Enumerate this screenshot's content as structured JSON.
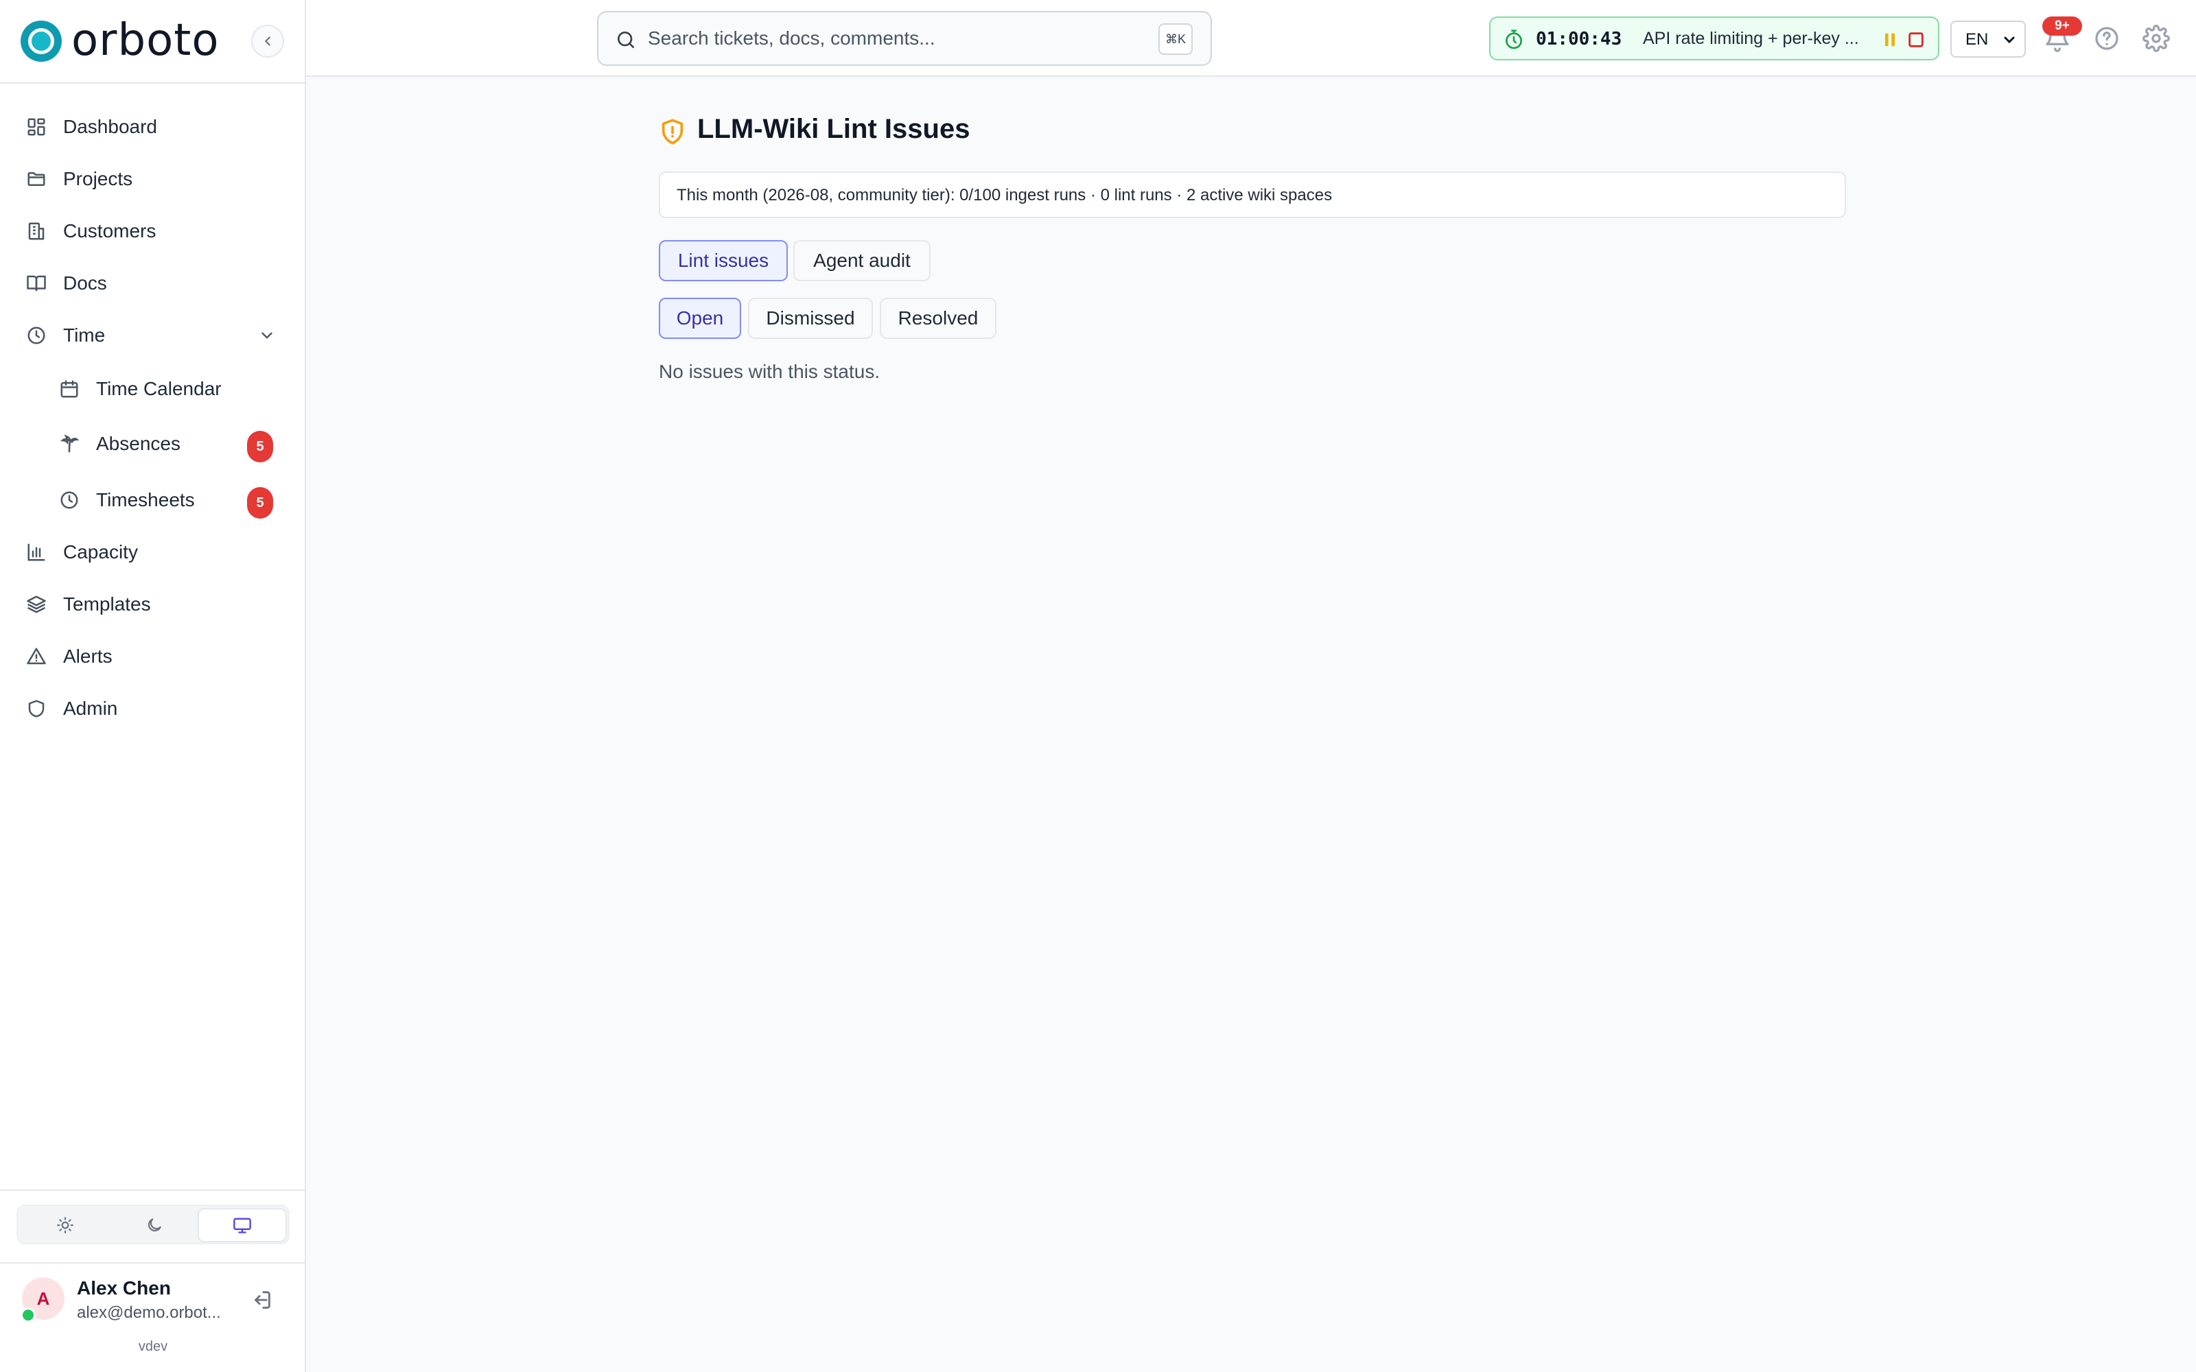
{
  "brand": {
    "name": "orboto"
  },
  "sidebar": {
    "items": [
      {
        "label": "Dashboard",
        "icon": "dashboard-icon"
      },
      {
        "label": "Projects",
        "icon": "folder-icon"
      },
      {
        "label": "Customers",
        "icon": "building-icon"
      },
      {
        "label": "Docs",
        "icon": "book-icon"
      },
      {
        "label": "Time",
        "icon": "clock-icon"
      },
      {
        "label": "Time Calendar",
        "icon": "calendar-icon"
      },
      {
        "label": "Absences",
        "icon": "palm-tree-icon",
        "badge": "5"
      },
      {
        "label": "Timesheets",
        "icon": "clock-icon",
        "badge": "5"
      },
      {
        "label": "Capacity",
        "icon": "bar-chart-icon"
      },
      {
        "label": "Templates",
        "icon": "layers-icon"
      },
      {
        "label": "Alerts",
        "icon": "alert-triangle-icon"
      },
      {
        "label": "Admin",
        "icon": "shield-icon"
      }
    ]
  },
  "user": {
    "initial": "A",
    "name": "Alex Chen",
    "email": "alex@demo.orbot...",
    "version": "vdev"
  },
  "search": {
    "placeholder": "Search tickets, docs, comments...",
    "shortcut": "⌘K"
  },
  "timer": {
    "elapsed": "01:00:43",
    "task": "API rate limiting + per-key ..."
  },
  "language": {
    "value": "EN"
  },
  "notifications": {
    "badge": "9+"
  },
  "page": {
    "title": "LLM-Wiki Lint Issues",
    "usage": "This month (2026-08, community tier): 0/100 ingest runs · 0 lint runs · 2 active wiki spaces",
    "tabs": [
      "Lint issues",
      "Agent audit"
    ],
    "status_filters": [
      "Open",
      "Dismissed",
      "Resolved"
    ],
    "empty_message": "No issues with this status."
  },
  "colors": {
    "accent": "#6366f1",
    "brand": "#17b7c9",
    "badge": "#e53935",
    "timer_border": "#86d9a3",
    "title_icon": "#f59e0b"
  }
}
